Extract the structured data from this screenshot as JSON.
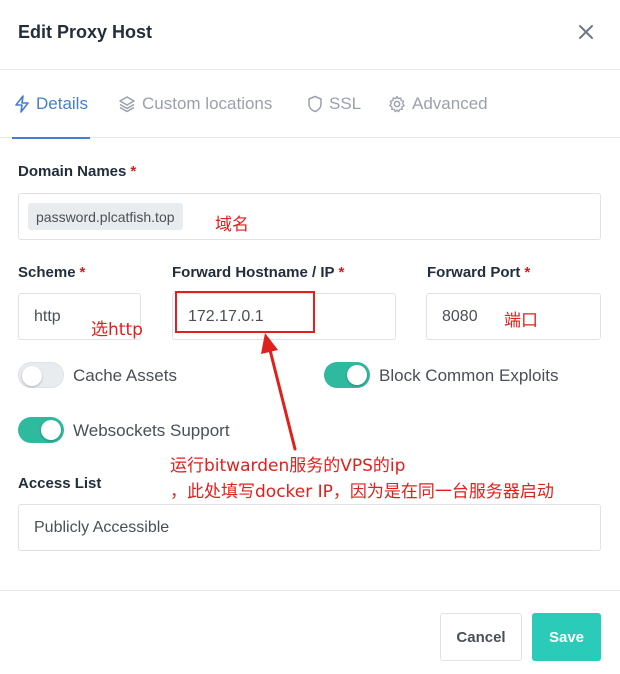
{
  "modal": {
    "title": "Edit Proxy Host"
  },
  "tabs": [
    {
      "label": "Details",
      "icon": "bolt-icon",
      "active": true
    },
    {
      "label": "Custom locations",
      "icon": "layers-icon",
      "active": false
    },
    {
      "label": "SSL",
      "icon": "shield-icon",
      "active": false
    },
    {
      "label": "Advanced",
      "icon": "gear-icon",
      "active": false
    }
  ],
  "form": {
    "domain_names": {
      "label": "Domain Names",
      "required_mark": "*",
      "chip": "password.plcatfish.top"
    },
    "scheme": {
      "label": "Scheme",
      "required_mark": "*",
      "value": "http"
    },
    "forward_hostname": {
      "label": "Forward Hostname / IP",
      "required_mark": "*",
      "value": "172.17.0.1"
    },
    "forward_port": {
      "label": "Forward Port",
      "required_mark": "*",
      "value": "8080"
    },
    "toggles": {
      "cache_assets": {
        "label": "Cache Assets",
        "enabled": false
      },
      "block_exploits": {
        "label": "Block Common Exploits",
        "enabled": true
      },
      "websockets": {
        "label": "Websockets Support",
        "enabled": true
      }
    },
    "access_list": {
      "label": "Access List",
      "value": "Publicly Accessible"
    }
  },
  "annotations": {
    "domain": "域名",
    "scheme": "选http",
    "port": "端口",
    "host_line1": "运行bitwarden服务的VPS的ip",
    "host_line2": "，此处填写docker IP，因为是在同一台服务器启动"
  },
  "footer": {
    "cancel_label": "Cancel",
    "save_label": "Save"
  },
  "colors": {
    "accent": "#467fcf",
    "toggle_on": "#2fb99e",
    "save": "#2bcbba",
    "annotation": "#e0201d",
    "required": "#cd201f"
  }
}
